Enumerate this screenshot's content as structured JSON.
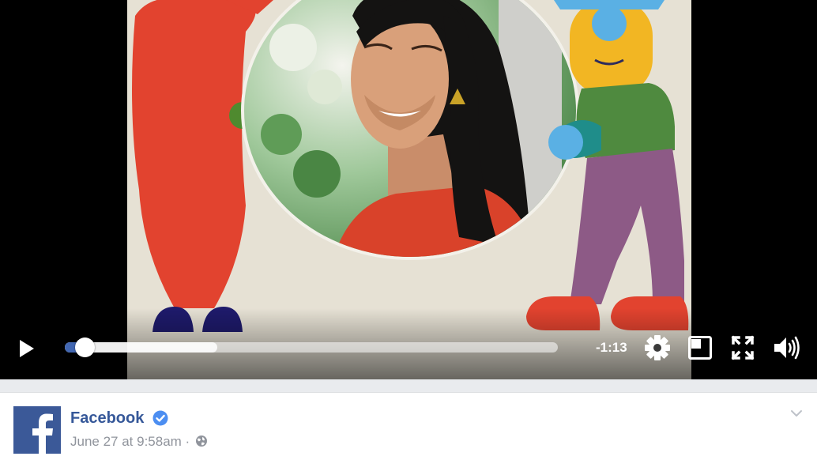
{
  "video": {
    "remaining_time": "-1:13",
    "progress_fraction": 0.04,
    "buffered_fraction": 0.31,
    "icons": {
      "play": "play-icon",
      "settings": "gear-icon",
      "pip": "picture-in-picture-icon",
      "fullscreen": "fullscreen-icon",
      "volume": "volume-icon"
    }
  },
  "post": {
    "page_name": "Facebook",
    "verified": true,
    "date": "June 27 at 9:58am",
    "separator": " · ",
    "privacy_icon": "globe-icon",
    "menu_icon": "chevron-down-icon"
  },
  "colors": {
    "brand": "#3b5998",
    "link": "#365899",
    "verified": "#4c8ef1",
    "progress": "#4267b2"
  }
}
